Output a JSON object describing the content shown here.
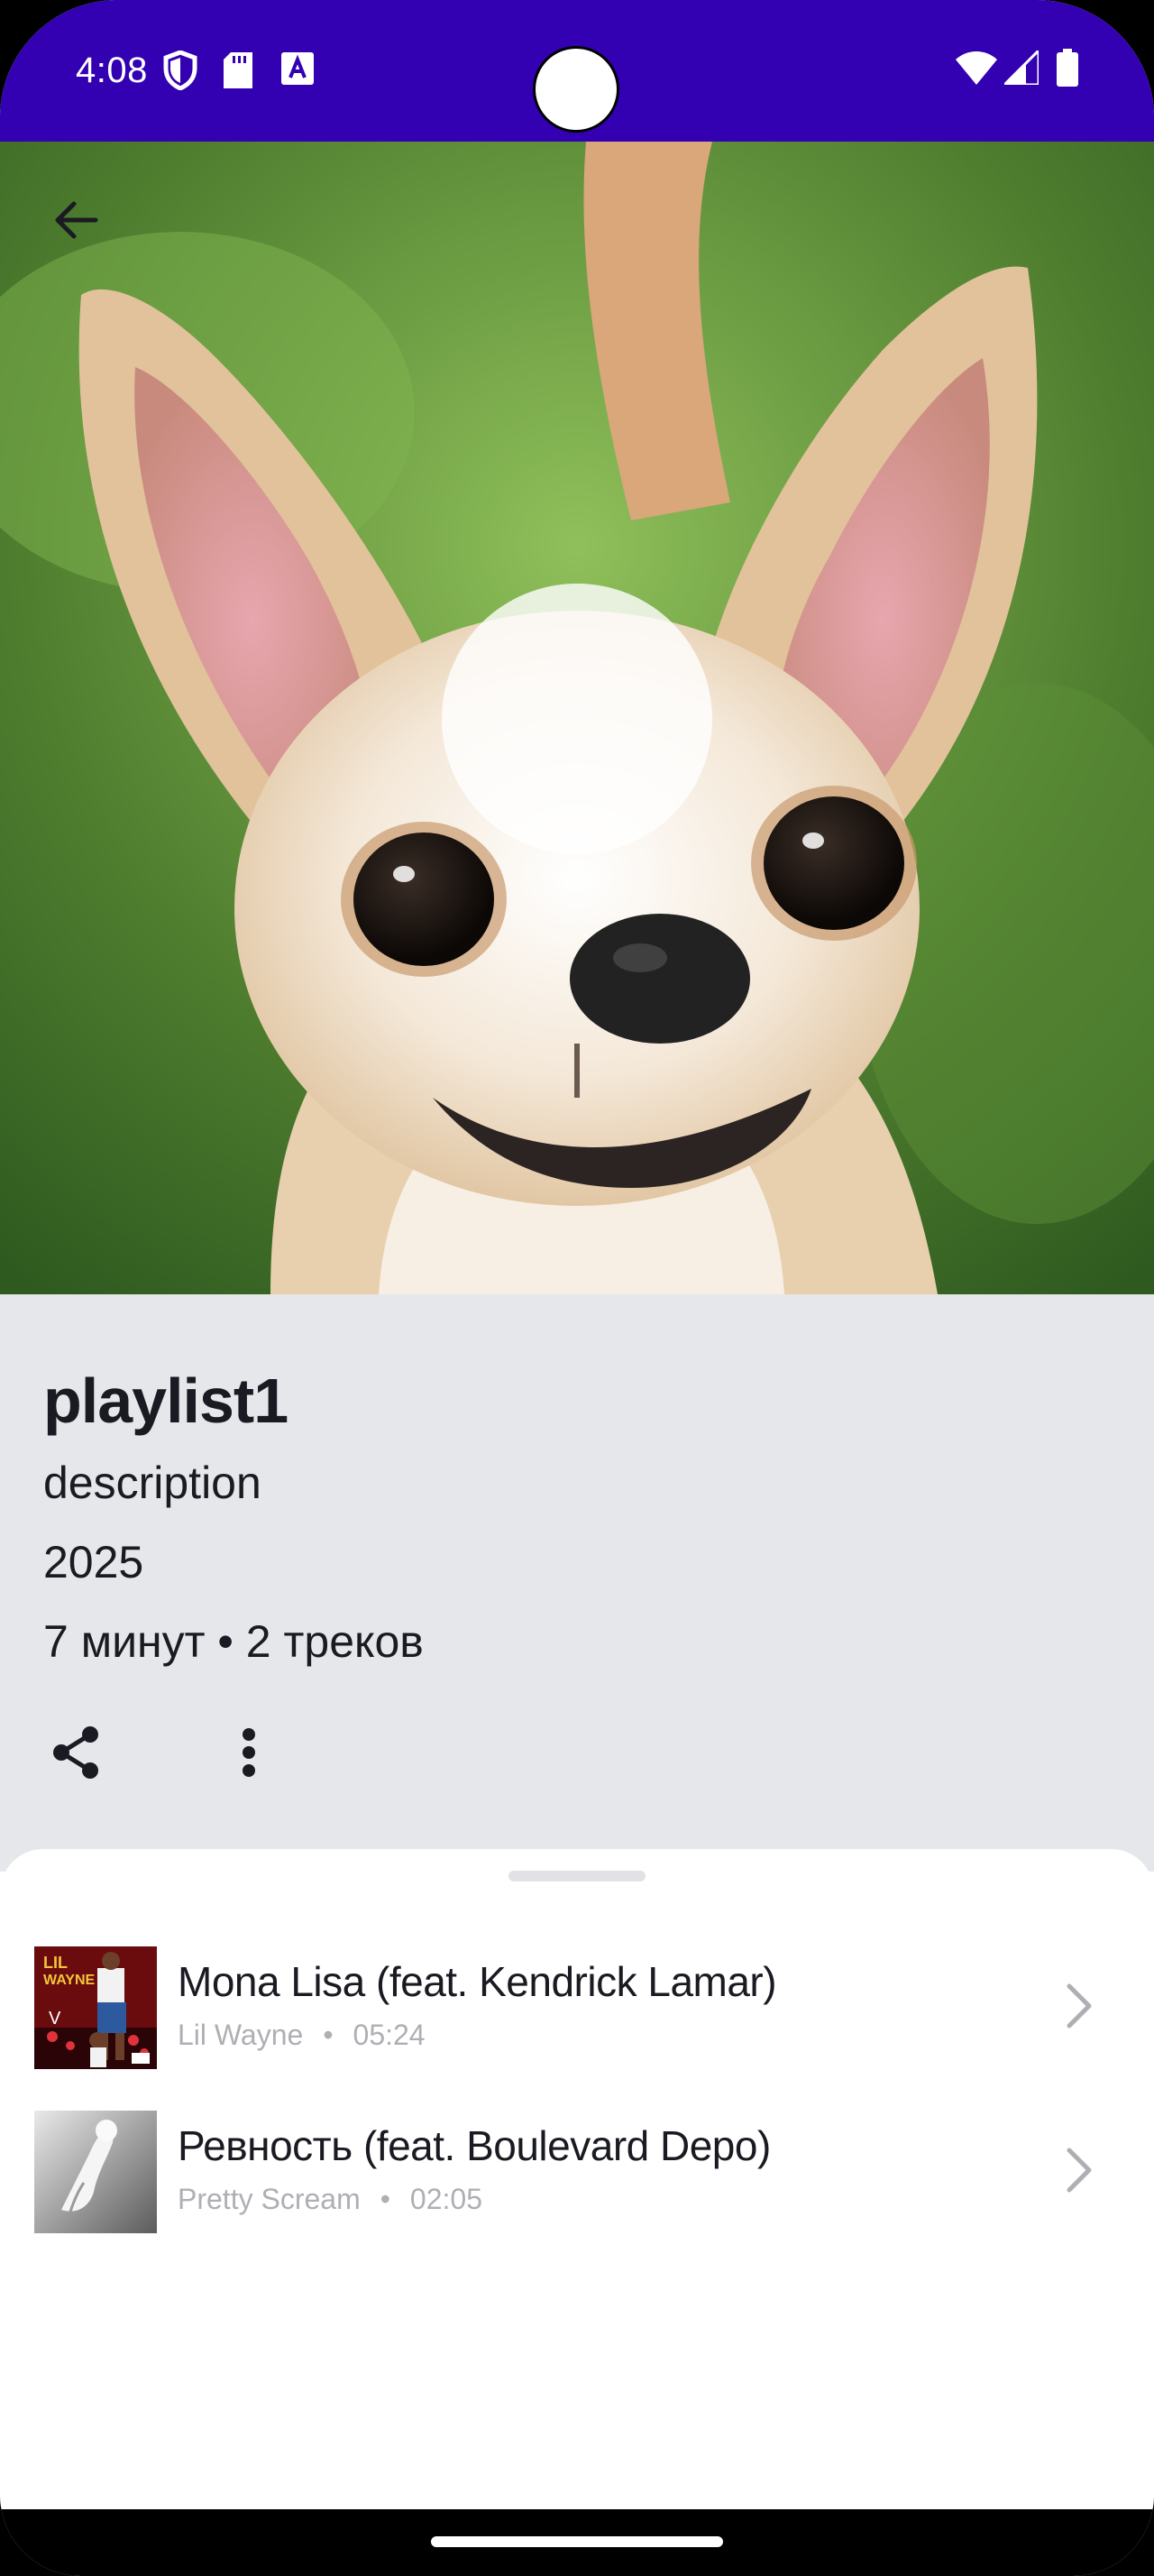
{
  "status_bar": {
    "time": "4:08",
    "background_color": "#3300b2",
    "left_icons": [
      "shield-icon",
      "sd-card-icon",
      "font-a-icon"
    ],
    "right_icons": [
      "wifi-icon",
      "cellular-icon",
      "battery-icon"
    ]
  },
  "hero": {
    "image_description_icon": "chihuahua-photo",
    "back_icon": "arrow-back-icon"
  },
  "playlist": {
    "title": "playlist1",
    "description": "description",
    "year": "2025",
    "meta": "7 минут • 2 треков",
    "actions": [
      "share-icon",
      "more-vert-icon"
    ]
  },
  "tracks": [
    {
      "title": "Mona Lisa (feat. Kendrick Lamar)",
      "artist": "Lil Wayne",
      "separator": "•",
      "duration": "05:24",
      "cover_art": "album-cover-lil-wayne"
    },
    {
      "title": "Ревность (feat. Boulevard Depo)",
      "artist": "Pretty Scream",
      "separator": "•",
      "duration": "02:05",
      "cover_art": "album-cover-grey"
    }
  ],
  "colors": {
    "accent": "#3300b2",
    "panel": "#e6e7ea",
    "text_primary": "#1a1b22",
    "text_secondary": "#aeafb4"
  }
}
